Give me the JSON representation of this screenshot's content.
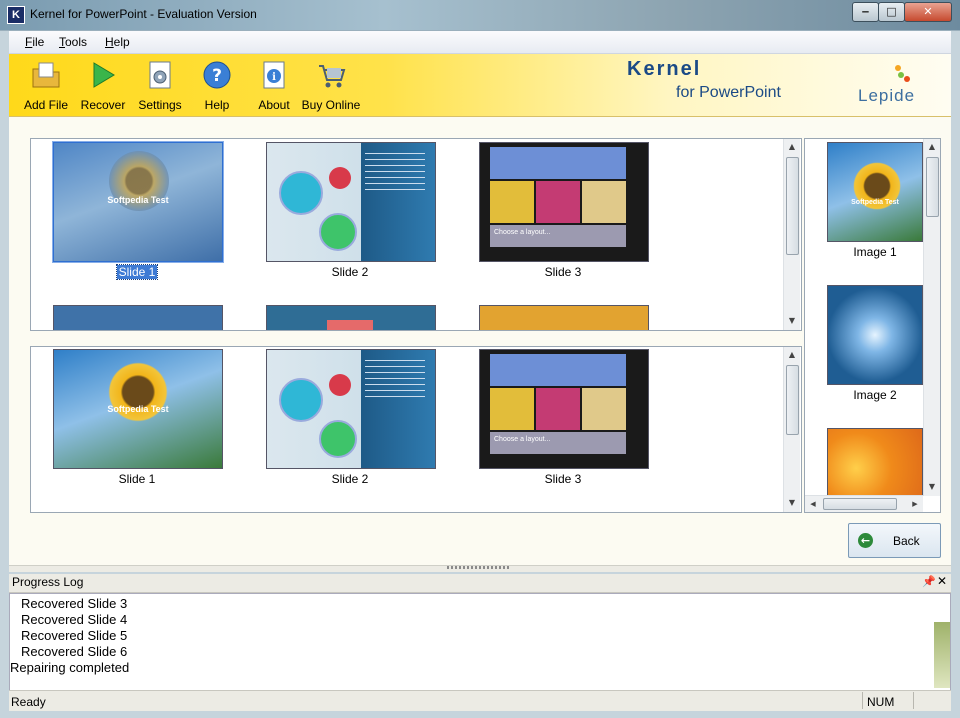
{
  "window": {
    "title": "Kernel for PowerPoint - Evaluation Version",
    "app_icon_letter": "K"
  },
  "window_buttons": {
    "minimize": "‒",
    "maximize": "□",
    "close": "✕"
  },
  "menu": [
    "File",
    "Tools",
    "Help"
  ],
  "toolbar": [
    "Add File",
    "Recover",
    "Settings",
    "Help",
    "About",
    "Buy Online"
  ],
  "brand": {
    "kernel": "Kernel",
    "subtitle": "for PowerPoint",
    "company": "Lepide"
  },
  "slides_top": [
    {
      "label": "Slide 1",
      "text": "Softpedia Test",
      "selected": true
    },
    {
      "label": "Slide 2"
    },
    {
      "label": "Slide 3",
      "text": "Choose a layout..."
    }
  ],
  "slides_bottom": [
    {
      "label": "Slide 1",
      "text": "Softpedia Test"
    },
    {
      "label": "Slide 2"
    },
    {
      "label": "Slide 3",
      "text": "Choose a layout..."
    }
  ],
  "images": [
    {
      "label": "Image 1",
      "text": "Softpedia Test"
    },
    {
      "label": "Image 2"
    }
  ],
  "back_button": "Back",
  "progress_log": {
    "title": "Progress Log",
    "lines": [
      "Recovered Slide 3",
      "Recovered Slide 4",
      "Recovered Slide 5",
      "Recovered Slide 6",
      "Repairing completed"
    ]
  },
  "status": {
    "text": "Ready",
    "num": "NUM"
  },
  "colors": {
    "toolbar_yellow": "#ffd91a",
    "selection_blue": "#3d7ad4",
    "brand_blue": "#1b4a86",
    "back_green": "#2d8a3a"
  }
}
